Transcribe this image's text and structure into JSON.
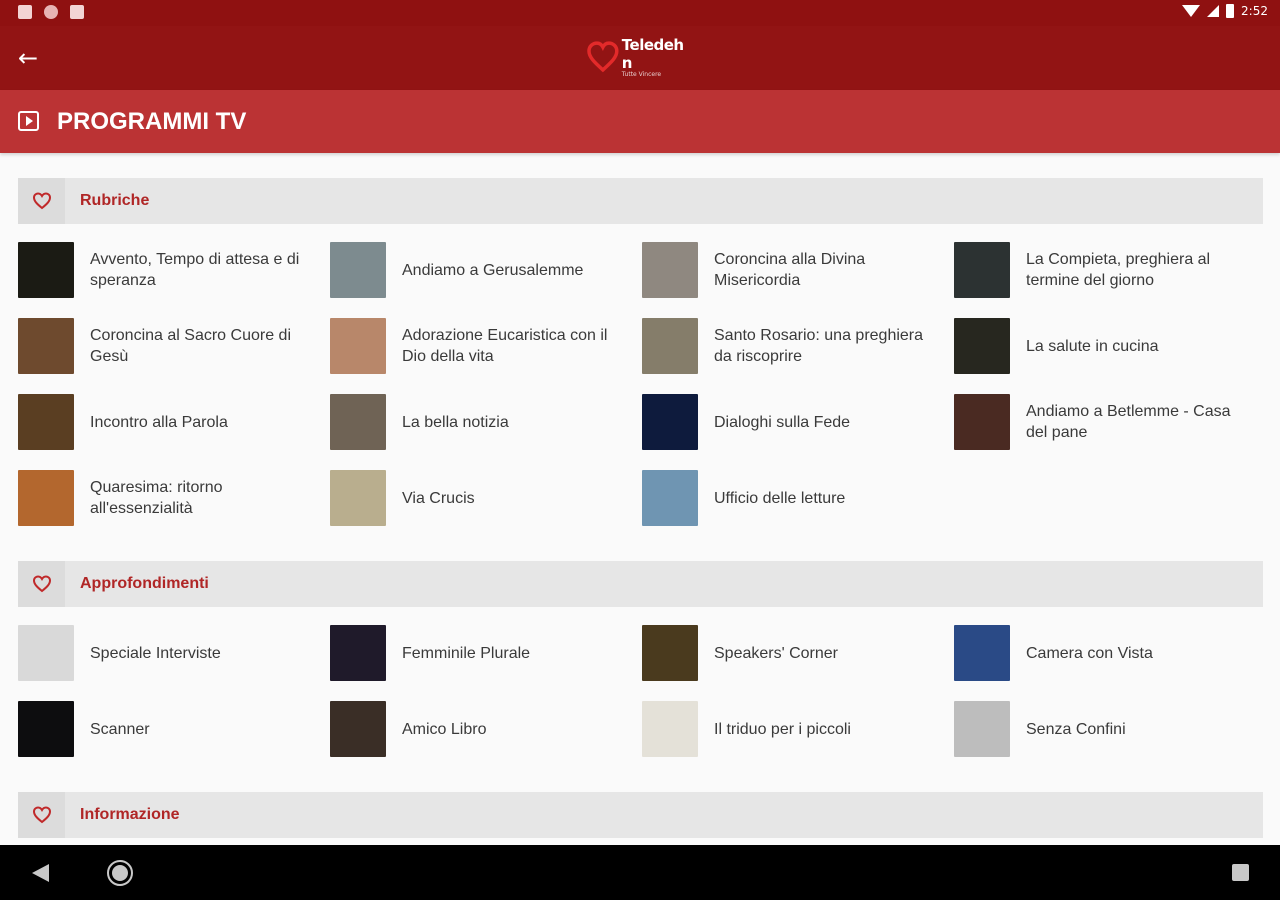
{
  "status_bar": {
    "time": "2:52"
  },
  "app_bar": {
    "logo_text": "Teledeh n",
    "logo_subtext": "Tutte Vincere"
  },
  "page": {
    "title": "PROGRAMMI TV"
  },
  "sections": [
    {
      "title": "Rubriche",
      "items": [
        {
          "label": "Avvento, Tempo di attesa e di speranza",
          "thumb_color": "#1b1b14"
        },
        {
          "label": "Andiamo a Gerusalemme",
          "thumb_color": "#7d8b8f"
        },
        {
          "label": "Coroncina alla Divina Misericordia",
          "thumb_color": "#8f8880"
        },
        {
          "label": "La Compieta, preghiera al termine del giorno",
          "thumb_color": "#2c3232"
        },
        {
          "label": "Coroncina al Sacro Cuore di Gesù",
          "thumb_color": "#6e4a2e"
        },
        {
          "label": "Adorazione Eucaristica con il Dio della vita",
          "thumb_color": "#b8876a"
        },
        {
          "label": "Santo Rosario: una preghiera da riscoprire",
          "thumb_color": "#857d6a"
        },
        {
          "label": "La salute in cucina",
          "thumb_color": "#27271f"
        },
        {
          "label": "Incontro alla Parola",
          "thumb_color": "#5a3e22"
        },
        {
          "label": "La bella notizia",
          "thumb_color": "#6f6355"
        },
        {
          "label": "Dialoghi sulla Fede",
          "thumb_color": "#0e1b3d"
        },
        {
          "label": "Andiamo a Betlemme - Casa del pane",
          "thumb_color": "#4a2a22"
        },
        {
          "label": "Quaresima: ritorno all'essenzialità",
          "thumb_color": "#b3672e"
        },
        {
          "label": "Via Crucis",
          "thumb_color": "#b9ae8e"
        },
        {
          "label": "Ufficio delle letture",
          "thumb_color": "#6f95b2"
        }
      ]
    },
    {
      "title": "Approfondimenti",
      "items": [
        {
          "label": "Speciale Interviste",
          "thumb_color": "#d9d9d9"
        },
        {
          "label": "Femminile Plurale",
          "thumb_color": "#1f1a2a"
        },
        {
          "label": "Speakers' Corner",
          "thumb_color": "#4a3a1e"
        },
        {
          "label": "Camera con Vista",
          "thumb_color": "#2a4a86"
        },
        {
          "label": "Scanner",
          "thumb_color": "#0d0d0f"
        },
        {
          "label": "Amico Libro",
          "thumb_color": "#3a2e26"
        },
        {
          "label": "Il triduo per i piccoli",
          "thumb_color": "#e4e1d8"
        },
        {
          "label": "Senza Confini",
          "thumb_color": "#bdbdbd"
        }
      ]
    },
    {
      "title": "Informazione",
      "items": []
    }
  ]
}
